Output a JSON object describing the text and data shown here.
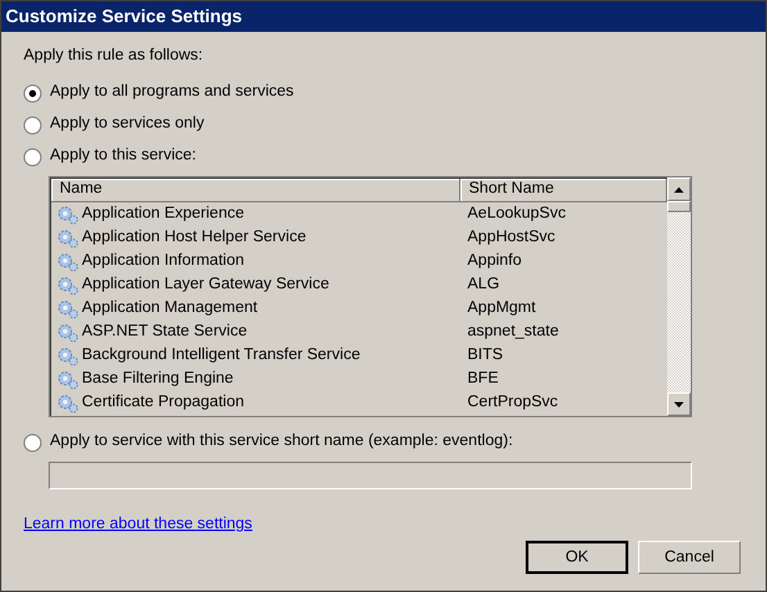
{
  "window": {
    "title": "Customize Service Settings"
  },
  "intro": "Apply this rule as follows:",
  "options": [
    {
      "label": "Apply to all programs and services",
      "selected": true
    },
    {
      "label": "Apply to services only",
      "selected": false
    },
    {
      "label": "Apply to this service:",
      "selected": false
    }
  ],
  "table": {
    "columns": [
      "Name",
      "Short Name"
    ],
    "rows": [
      [
        "Application Experience",
        "AeLookupSvc"
      ],
      [
        "Application Host Helper Service",
        "AppHostSvc"
      ],
      [
        "Application Information",
        "Appinfo"
      ],
      [
        "Application Layer Gateway Service",
        "ALG"
      ],
      [
        "Application Management",
        "AppMgmt"
      ],
      [
        "ASP.NET State Service",
        "aspnet_state"
      ],
      [
        "Background Intelligent Transfer Service",
        "BITS"
      ],
      [
        "Base Filtering Engine",
        "BFE"
      ],
      [
        "Certificate Propagation",
        "CertPropSvc"
      ]
    ]
  },
  "short_name_option": {
    "label": "Apply to service with this service short name (example: eventlog):",
    "selected": false
  },
  "link": "Learn more about these settings",
  "buttons": [
    "OK",
    "Cancel"
  ]
}
